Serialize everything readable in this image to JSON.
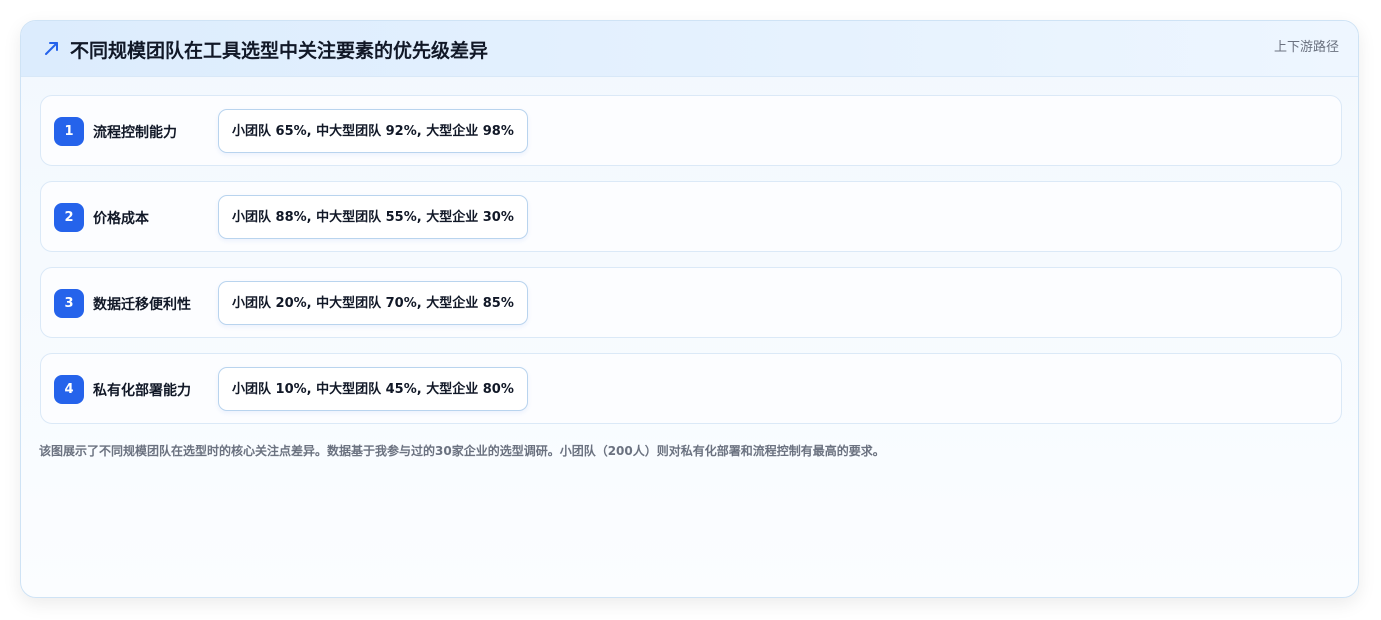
{
  "header": {
    "title": "不同规模团队在工具选型中关注要素的优先级差异",
    "tag": "上下游路径",
    "icon": "trend-arrow-icon"
  },
  "rows": [
    {
      "number": "1",
      "label": "流程控制能力",
      "value": "小团队 65%, 中大型团队 92%, 大型企业 98%"
    },
    {
      "number": "2",
      "label": "价格成本",
      "value": "小团队 88%, 中大型团队 55%, 大型企业 30%"
    },
    {
      "number": "3",
      "label": "数据迁移便利性",
      "value": "小团队 20%, 中大型团队 70%, 大型企业 85%"
    },
    {
      "number": "4",
      "label": "私有化部署能力",
      "value": "小团队 10%, 中大型团队 45%, 大型企业 80%"
    }
  ],
  "footnote": "该图展示了不同规模团队在选型时的核心关注点差异。数据基于我参与过的30家企业的选型调研。小团队（200人）则对私有化部署和流程控制有最高的要求。",
  "colors": {
    "accent": "#2563eb",
    "header_bg": "#dcecfd",
    "border": "#dbe9f7"
  }
}
